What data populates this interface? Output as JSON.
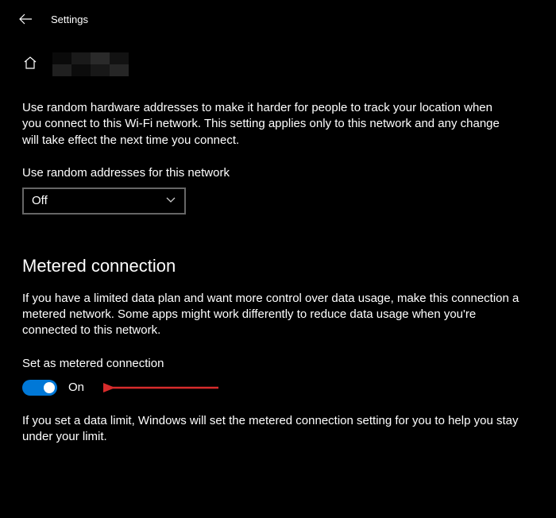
{
  "header": {
    "title": "Settings"
  },
  "random_hw": {
    "description": "Use random hardware addresses to make it harder for people to track your location when you connect to this Wi-Fi network. This setting applies only to this network and any change will take effect the next time you connect.",
    "label": "Use random addresses for this network",
    "dropdown_value": "Off"
  },
  "metered": {
    "title": "Metered connection",
    "description": "If you have a limited data plan and want more control over data usage, make this connection a metered network. Some apps might work differently to reduce data usage when you're connected to this network.",
    "toggle_label": "Set as metered connection",
    "toggle_state": "On",
    "footnote": "If you set a data limit, Windows will set the metered connection setting for you to help you stay under your limit."
  },
  "colors": {
    "accent": "#0078D7",
    "arrow": "#D82C2C"
  }
}
